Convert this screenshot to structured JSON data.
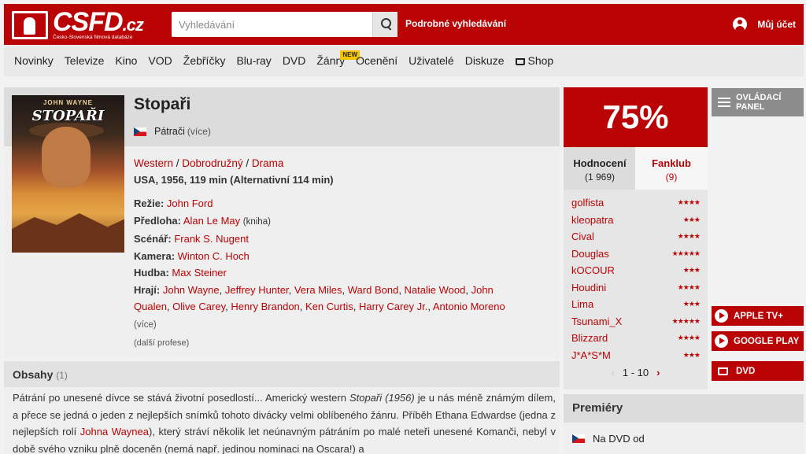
{
  "header": {
    "logo": "CSFD",
    "logo_tld": ".cz",
    "logo_tagline": "Česko-Slovenská filmová databáze",
    "search_placeholder": "Vyhledávání",
    "advanced_search": "Podrobné vyhledávání",
    "account": "Můj účet"
  },
  "nav": {
    "items": [
      "Novinky",
      "Televize",
      "Kino",
      "VOD",
      "Žebříčky",
      "Blu-ray",
      "DVD",
      "Žánry",
      "Ocenění",
      "Uživatelé",
      "Diskuze",
      "Shop"
    ],
    "new_badge": "NEW"
  },
  "film": {
    "title": "Stopaři",
    "alt_title": "Pátrači",
    "alt_more": "(více)",
    "genres": [
      "Western",
      "Dobrodružný",
      "Drama"
    ],
    "origin": "USA, 1956, 119 min (Alternativní 114 min)",
    "poster": {
      "actor": "JOHN WAYNE",
      "title": "STOPAŘI"
    },
    "credits": {
      "director_label": "Režie:",
      "director": "John Ford",
      "source_label": "Předloha:",
      "source": "Alan Le May",
      "source_type": "(kniha)",
      "writer_label": "Scénář:",
      "writer": "Frank S. Nugent",
      "camera_label": "Kamera:",
      "camera": "Winton C. Hoch",
      "music_label": "Hudba:",
      "music": "Max Steiner",
      "cast_label": "Hrají:",
      "cast": [
        "John Wayne",
        "Jeffrey Hunter",
        "Vera Miles",
        "Ward Bond",
        "Natalie Wood",
        "John Qualen",
        "Olive Carey",
        "Henry Brandon",
        "Ken Curtis",
        "Harry Carey Jr.",
        "Antonio Moreno"
      ],
      "cast_more": "(více)",
      "more_professions": "(další profese)"
    }
  },
  "rating": {
    "score": "75%",
    "tab_ratings": "Hodnocení",
    "tab_ratings_count": "(1 969)",
    "tab_fanclub": "Fanklub",
    "tab_fanclub_count": "(9)",
    "users": [
      {
        "name": "golfista",
        "stars": 4
      },
      {
        "name": "kleopatra",
        "stars": 3
      },
      {
        "name": "Cival",
        "stars": 4
      },
      {
        "name": "Douglas",
        "stars": 5
      },
      {
        "name": "kOCOUR",
        "stars": 3
      },
      {
        "name": "Houdini",
        "stars": 4
      },
      {
        "name": "Lima",
        "stars": 3
      },
      {
        "name": "Tsunami_X",
        "stars": 5
      },
      {
        "name": "Blizzard",
        "stars": 4
      },
      {
        "name": "J*A*S*M",
        "stars": 3
      }
    ],
    "pager": "1 - 10"
  },
  "side": {
    "control_panel": "OVLÁDACÍ PANEL",
    "apple_tv": "APPLE TV+",
    "google_play": "GOOGLE PLAY",
    "dvd": "DVD"
  },
  "plot": {
    "heading": "Obsahy",
    "count": "(1)",
    "text_1": "Pátrání po unesené dívce se stává životní posedlostí... Americký western ",
    "text_italic": "Stopaři (1956)",
    "text_2": " je u nás méně známým dílem, a přece se jedná o jeden z nejlepších snímků tohoto divácky velmi oblíbeného žánru. Příběh Ethana Edwardse (jedna z nejlepších rolí ",
    "text_link": "Johna Waynea",
    "text_3": "), který stráví několik let neúnavným pátráním po malé neteři unesené Komanči, nebyl v době svého vzniku plně doceněn (nemá např. jedinou nominaci na Oscara!) a"
  },
  "premieres": {
    "heading": "Premiéry",
    "row": "Na DVD od"
  },
  "colors": {
    "brand": "#ba0305",
    "star": "#ba0305"
  }
}
